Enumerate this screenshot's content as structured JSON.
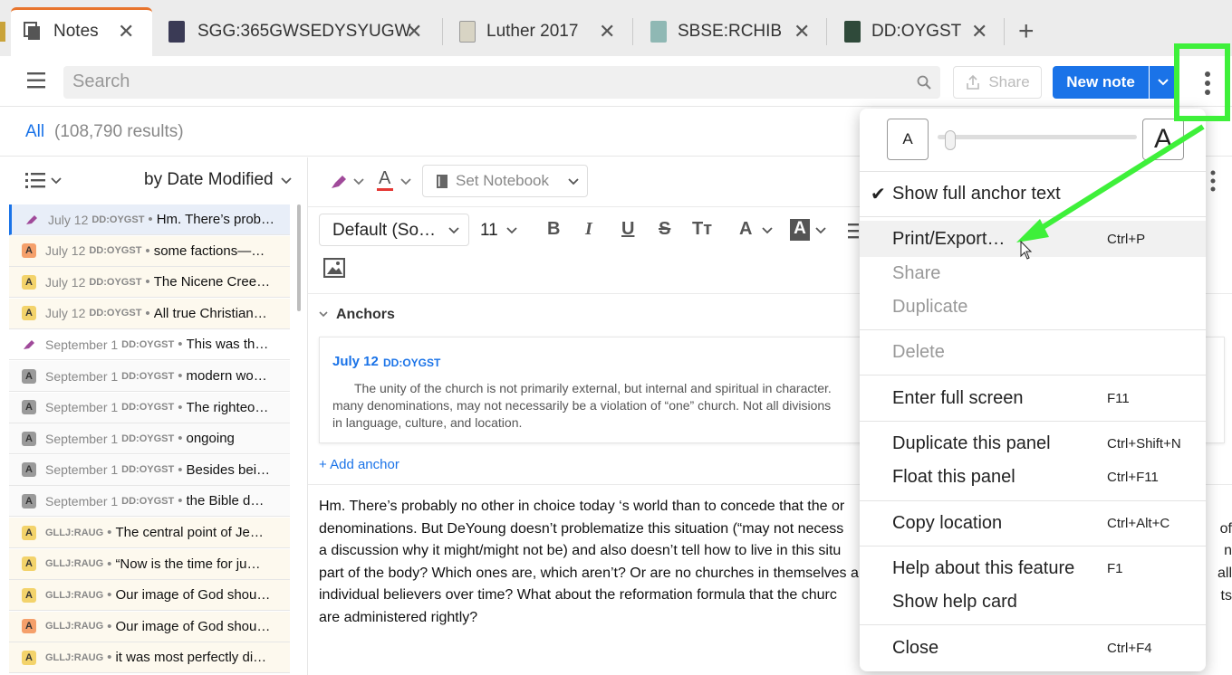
{
  "tabs": [
    {
      "label": "Notes",
      "active": true
    },
    {
      "label": "SGG:365GWSEDYSYUGW"
    },
    {
      "label": "Luther 2017"
    },
    {
      "label": "SBSE:RCHIB"
    },
    {
      "label": "DD:OYGST"
    }
  ],
  "toolbar": {
    "search_placeholder": "Search",
    "share_label": "Share",
    "new_note_label": "New note"
  },
  "results": {
    "filter": "All",
    "count": "(108,790 results)"
  },
  "list": {
    "sort_label": "by Date Modified",
    "items": [
      {
        "date": "July 12",
        "source": "DD:OYGST",
        "text": "Hm. There’s prob…",
        "icon": "highlighter",
        "color": "#a04a9a",
        "selected": true
      },
      {
        "date": "July 12",
        "source": "DD:OYGST",
        "text": "some factions—…",
        "icon": "anchor-a",
        "color": "#f5a06b"
      },
      {
        "date": "July 12",
        "source": "DD:OYGST",
        "text": "The Nicene Cree…",
        "icon": "anchor-a",
        "color": "#f3d36b"
      },
      {
        "date": "July 12",
        "source": "DD:OYGST",
        "text": "All true Christian…",
        "icon": "anchor-a",
        "color": "#f3d36b"
      },
      {
        "date": "September 1",
        "source": "DD:OYGST",
        "text": "This was th…",
        "icon": "highlighter",
        "color": "#a04a9a"
      },
      {
        "date": "September 1",
        "source": "DD:OYGST",
        "text": "modern wo…",
        "icon": "anchor-a",
        "color": "#9a9a9a"
      },
      {
        "date": "September 1",
        "source": "DD:OYGST",
        "text": "The righteo…",
        "icon": "anchor-a",
        "color": "#9a9a9a"
      },
      {
        "date": "September 1",
        "source": "DD:OYGST",
        "text": "ongoing",
        "icon": "anchor-a",
        "color": "#9a9a9a"
      },
      {
        "date": "September 1",
        "source": "DD:OYGST",
        "text": "Besides bei…",
        "icon": "anchor-a",
        "color": "#9a9a9a"
      },
      {
        "date": "September 1",
        "source": "DD:OYGST",
        "text": "the Bible d…",
        "icon": "anchor-a",
        "color": "#9a9a9a"
      },
      {
        "date": "",
        "source": "GLLJ:RAUG",
        "text": "The central point of Je…",
        "icon": "anchor-a",
        "color": "#f3d36b"
      },
      {
        "date": "",
        "source": "GLLJ:RAUG",
        "text": "“Now is the time for ju…",
        "icon": "anchor-a",
        "color": "#f3d36b"
      },
      {
        "date": "",
        "source": "GLLJ:RAUG",
        "text": "Our image of God shou…",
        "icon": "anchor-a",
        "color": "#f3d36b"
      },
      {
        "date": "",
        "source": "GLLJ:RAUG",
        "text": "Our image of God shou…",
        "icon": "anchor-a",
        "color": "#f5a06b"
      },
      {
        "date": "",
        "source": "GLLJ:RAUG",
        "text": "it was most perfectly di…",
        "icon": "anchor-a",
        "color": "#f3d36b"
      }
    ]
  },
  "editor": {
    "set_notebook": "Set Notebook",
    "font_family": "Default (So…",
    "font_size": "11",
    "anchors_label": "Anchors",
    "anchor_ref": "July 12",
    "anchor_src": "DD:OYGST",
    "anchor_text": "The unity of the church is not primarily external, but internal and spiritual in character. … many denominations, may not necessarily be a violation of “one” church. Not all divisions … in language, culture, and location.",
    "anchor_line1": "The unity of the church is not primarily external, but internal and spiritual in character.",
    "anchor_line2": "many denominations, may not necessarily be a violation of “one” church. Not all divisions",
    "anchor_line3": "in language, culture, and location.",
    "add_anchor": "+ Add anchor",
    "body_lines": [
      "Hm. There’s probably no other in choice today ‘s world than to concede that the or",
      "denominations. But DeYoung doesn’t problematize this situation (“may not necess",
      "a discussion why it might/might not be) and also doesn’t tell how to live in this situ",
      "part of the body? Which ones are, which aren’t? Or are no churches in themselves a",
      "individual believers over time? What about the reformation formula that the churc",
      "are administered rightly?"
    ],
    "right_fragments": [
      "of",
      "n",
      "all",
      "ts"
    ]
  },
  "menu": {
    "font_small": "A",
    "font_large": "A",
    "items": [
      {
        "label": "Show full anchor text",
        "checked": true
      },
      {
        "label": "Print/Export…",
        "shortcut": "Ctrl+P"
      },
      {
        "label": "Share",
        "disabled": true
      },
      {
        "label": "Duplicate",
        "disabled": true
      },
      {
        "label": "Delete",
        "disabled": true
      },
      {
        "label": "Enter full screen",
        "shortcut": "F11"
      },
      {
        "label": "Duplicate this panel",
        "shortcut": "Ctrl+Shift+N"
      },
      {
        "label": "Float this panel",
        "shortcut": "Ctrl+F11"
      },
      {
        "label": "Copy location",
        "shortcut": "Ctrl+Alt+C"
      },
      {
        "label": "Help about this feature",
        "shortcut": "F1"
      },
      {
        "label": "Show help card"
      },
      {
        "label": "Close",
        "shortcut": "Ctrl+F4"
      }
    ]
  },
  "colors": {
    "accent": "#1a73e8",
    "annotation_green": "#3ef03a",
    "active_tab_border": "#e8742c"
  }
}
